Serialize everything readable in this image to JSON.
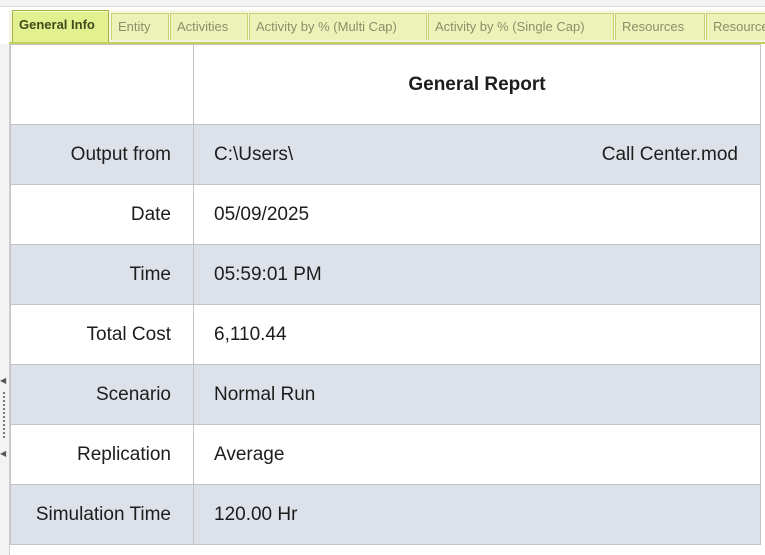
{
  "tabs": [
    {
      "label": "General Info",
      "active": true
    },
    {
      "label": "Entity",
      "active": false
    },
    {
      "label": "Activities",
      "active": false
    },
    {
      "label": "Activity by % (Multi Cap)",
      "active": false
    },
    {
      "label": "Activity by % (Single Cap)",
      "active": false
    },
    {
      "label": "Resources",
      "active": false
    },
    {
      "label": "Resources",
      "active": false
    }
  ],
  "report": {
    "title": "General Report",
    "output_from": {
      "label": "Output from",
      "path": "C:\\Users\\",
      "file": "Call Center.mod"
    },
    "rows": [
      {
        "label": "Date",
        "value": "05/09/2025"
      },
      {
        "label": "Time",
        "value": "05:59:01 PM"
      },
      {
        "label": "Total Cost",
        "value": "6,110.44"
      },
      {
        "label": "Scenario",
        "value": "Normal Run"
      },
      {
        "label": "Replication",
        "value": "Average"
      },
      {
        "label": "Simulation Time",
        "value": "120.00 Hr"
      }
    ]
  },
  "colors": {
    "title": "#1f5bc6",
    "shaded_row": "#dde1e9",
    "active_tab": "#e3f08f",
    "tab": "#edf3b8"
  }
}
